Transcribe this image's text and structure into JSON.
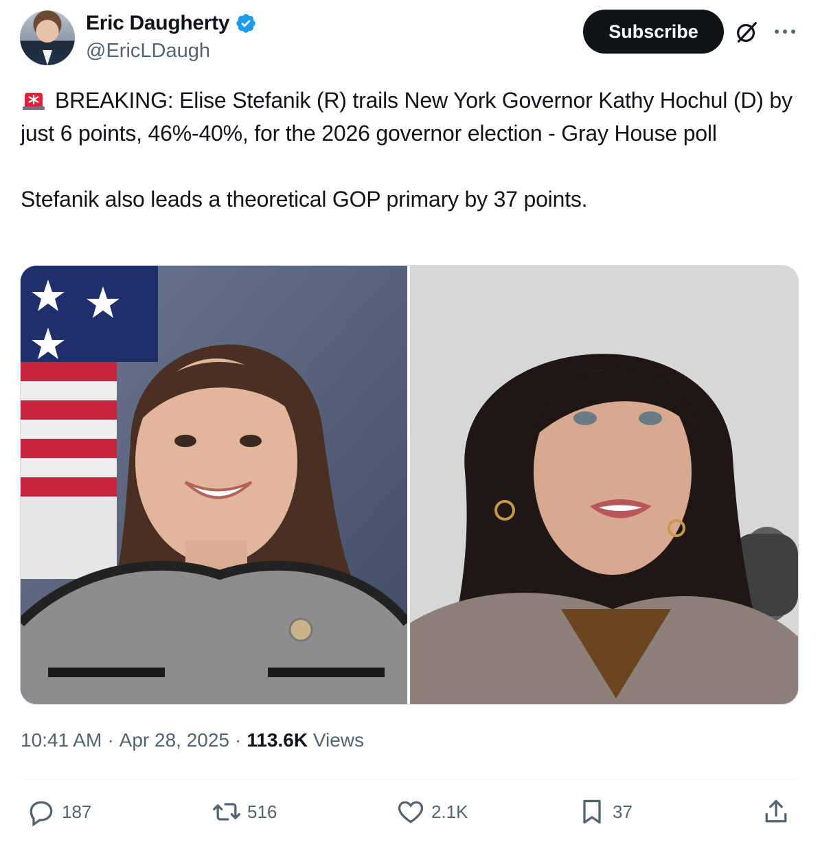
{
  "author": {
    "name": "Eric Daugherty",
    "handle": "@EricLDaugh",
    "verified": true
  },
  "header": {
    "subscribe_label": "Subscribe"
  },
  "tweet": {
    "line1": "BREAKING: Elise Stefanik (R) trails New York Governor Kathy Hochul (D) by just 6 points, 46%-40%, for the 2026 governor election - Gray House poll",
    "line2": "Stefanik also leads a theoretical GOP primary by 37 points."
  },
  "meta": {
    "time": "10:41 AM",
    "sep1": "·",
    "date": "Apr 28, 2025",
    "sep2": "·",
    "views_count": "113.6K",
    "views_label": "Views"
  },
  "actions": {
    "replies": "187",
    "reposts": "516",
    "likes": "2.1K",
    "bookmarks": "37"
  },
  "colors": {
    "text_primary": "#0f1419",
    "text_secondary": "#536471",
    "verified_blue": "#1d9bf0",
    "button_dark": "#0f1419",
    "siren_red": "#e0203a"
  },
  "icons": [
    "siren-icon",
    "verified-badge-icon",
    "grok-icon",
    "more-icon",
    "reply-icon",
    "repost-icon",
    "like-icon",
    "bookmark-icon",
    "share-icon"
  ]
}
